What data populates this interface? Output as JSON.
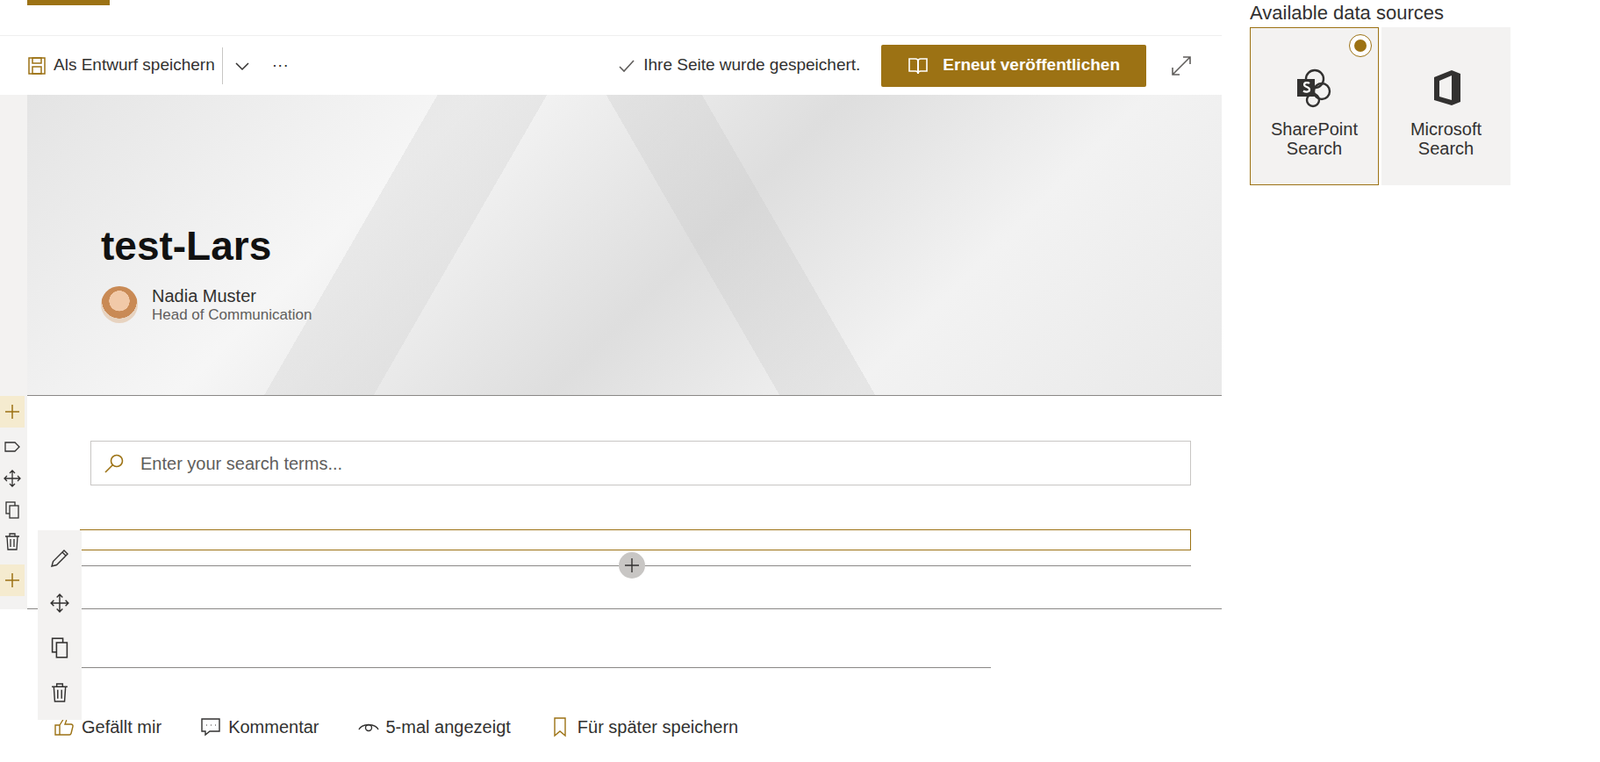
{
  "panel": {
    "heading": "Available data sources"
  },
  "toolbar": {
    "save_draft": "Als Entwurf speichern",
    "more": "···",
    "status": "Ihre Seite wurde gespeichert.",
    "publish": "Erneut veröffentlichen"
  },
  "page": {
    "title": "test-Lars",
    "author": {
      "name": "Nadia Muster",
      "role": "Head of Communication"
    }
  },
  "search": {
    "placeholder": "Enter your search terms..."
  },
  "data_sources": [
    {
      "label": "SharePoint Search",
      "selected": true
    },
    {
      "label": "Microsoft Search",
      "selected": false
    }
  ],
  "footer_actions": [
    {
      "label": "Gefällt mir"
    },
    {
      "label": "Kommentar"
    },
    {
      "label": "5-mal angezeigt"
    },
    {
      "label": "Für später speichern"
    }
  ]
}
